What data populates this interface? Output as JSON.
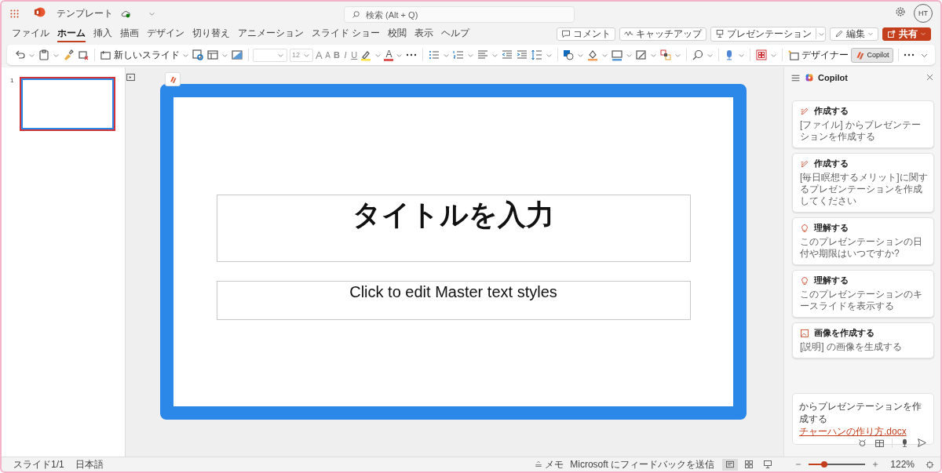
{
  "app": {
    "title": "テンプレート",
    "search_placeholder": "検索 (Alt + Q)",
    "avatar": "HT"
  },
  "menu_tabs": [
    {
      "label": "ファイル",
      "selected": false
    },
    {
      "label": "ホーム",
      "selected": true
    },
    {
      "label": "挿入",
      "selected": false
    },
    {
      "label": "描画",
      "selected": false
    },
    {
      "label": "デザイン",
      "selected": false
    },
    {
      "label": "切り替え",
      "selected": false
    },
    {
      "label": "アニメーション",
      "selected": false
    },
    {
      "label": "スライド ショー",
      "selected": false
    },
    {
      "label": "校閲",
      "selected": false
    },
    {
      "label": "表示",
      "selected": false
    },
    {
      "label": "ヘルプ",
      "selected": false
    }
  ],
  "actions": [
    {
      "label": "コメント",
      "kind": "comment"
    },
    {
      "label": "キャッチアップ",
      "kind": "catchup"
    },
    {
      "label": "プレゼンテーション",
      "kind": "present"
    },
    {
      "label": "編集",
      "kind": "edit"
    },
    {
      "label": "共有",
      "kind": "share"
    }
  ],
  "ribbon": {
    "new_slide": "新しいスライド",
    "font_size": "12",
    "text_tools": [
      {
        "label": "A",
        "kind": "grow"
      },
      {
        "label": "A",
        "kind": "shrink"
      },
      {
        "label": "B",
        "kind": "bold"
      },
      {
        "label": "I",
        "kind": "italic"
      },
      {
        "label": "U",
        "kind": "underline"
      }
    ],
    "font_color": "A",
    "designer": "デザイナー",
    "copilot": {
      "label": "Copilot",
      "selected": true
    }
  },
  "thumbnails": [
    {
      "number": "1",
      "selected": true
    }
  ],
  "slide": {
    "title": "タイトルを入力",
    "subtitle": "Click to edit Master text styles"
  },
  "copilot": {
    "title": "Copilot",
    "cards": [
      {
        "kind": "create",
        "heading": "作成する",
        "body": "[ファイル] からプレゼンテーションを作成する"
      },
      {
        "kind": "create",
        "heading": "作成する",
        "body": "[毎日瞑想するメリット]に関するプレゼンテーションを作成してください"
      },
      {
        "kind": "understand",
        "heading": "理解する",
        "body": "このプレゼンテーションの日付や期限はいつですか?"
      },
      {
        "kind": "understand",
        "heading": "理解する",
        "body": "このプレゼンテーションのキースライドを表示する"
      },
      {
        "kind": "image",
        "heading": "画像を作成する",
        "body": "[説明] の画像を生成する"
      }
    ],
    "prompt": {
      "text": "からプレゼンテーションを作成する",
      "link": "チャーハンの作り方.docx"
    }
  },
  "status_bar": {
    "slide_count": "スライド1/1",
    "language": "日本語",
    "notes": "メモ",
    "feedback": "Microsoft にフィードバックを送信",
    "views": [
      {
        "kind": "normal",
        "selected": true
      },
      {
        "kind": "sorter",
        "selected": false
      },
      {
        "kind": "reading",
        "selected": false
      }
    ],
    "zoom": {
      "level": 0.28,
      "reading": "122%"
    }
  }
}
